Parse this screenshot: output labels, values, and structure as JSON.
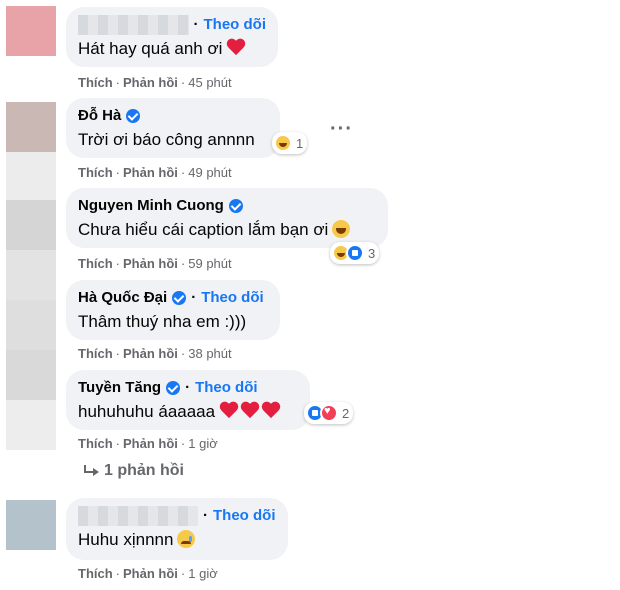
{
  "action_labels": {
    "like": "Thích",
    "reply": "Phản hồi",
    "separator": "·"
  },
  "colors": {
    "accent": "#1877f2",
    "bubble": "#f0f2f5",
    "secondary_text": "#65676b"
  },
  "comments": [
    {
      "name": "",
      "follow": "Theo dõi",
      "text": "Hát hay quá anh ơi",
      "time": "45 phút",
      "avatar_color": "#e8a3a8"
    },
    {
      "name": "Đỗ Hà",
      "text": "Trời ơi báo công annnn",
      "time": "49 phút",
      "reaction_count": "1",
      "avatar_color": "#c6b5b1"
    },
    {
      "name": "Nguyen Minh Cuong",
      "text": "Chưa hiểu cái caption lắm bạn ơi",
      "time": "59 phút",
      "reaction_count": "3",
      "avatar_color": "#d2d2d2"
    },
    {
      "name": "Hà Quốc Đại",
      "follow": "Theo dõi",
      "text": "Thâm thuý nha em :)))",
      "time": "38 phút",
      "avatar_color": "#dcdcdc"
    },
    {
      "name": "Tuyền Tăng",
      "follow": "Theo dõi",
      "text": "huhuhuhu áaaaaa",
      "time": "1 giờ",
      "reaction_count": "2",
      "avatar_color": "#d8d8d8"
    },
    {
      "name": "",
      "follow": "Theo dõi",
      "text": "Huhu xịnnnn",
      "time": "1 giờ",
      "avatar_color": "#b4c2cc"
    }
  ],
  "replies_link": "1 phản hồi"
}
